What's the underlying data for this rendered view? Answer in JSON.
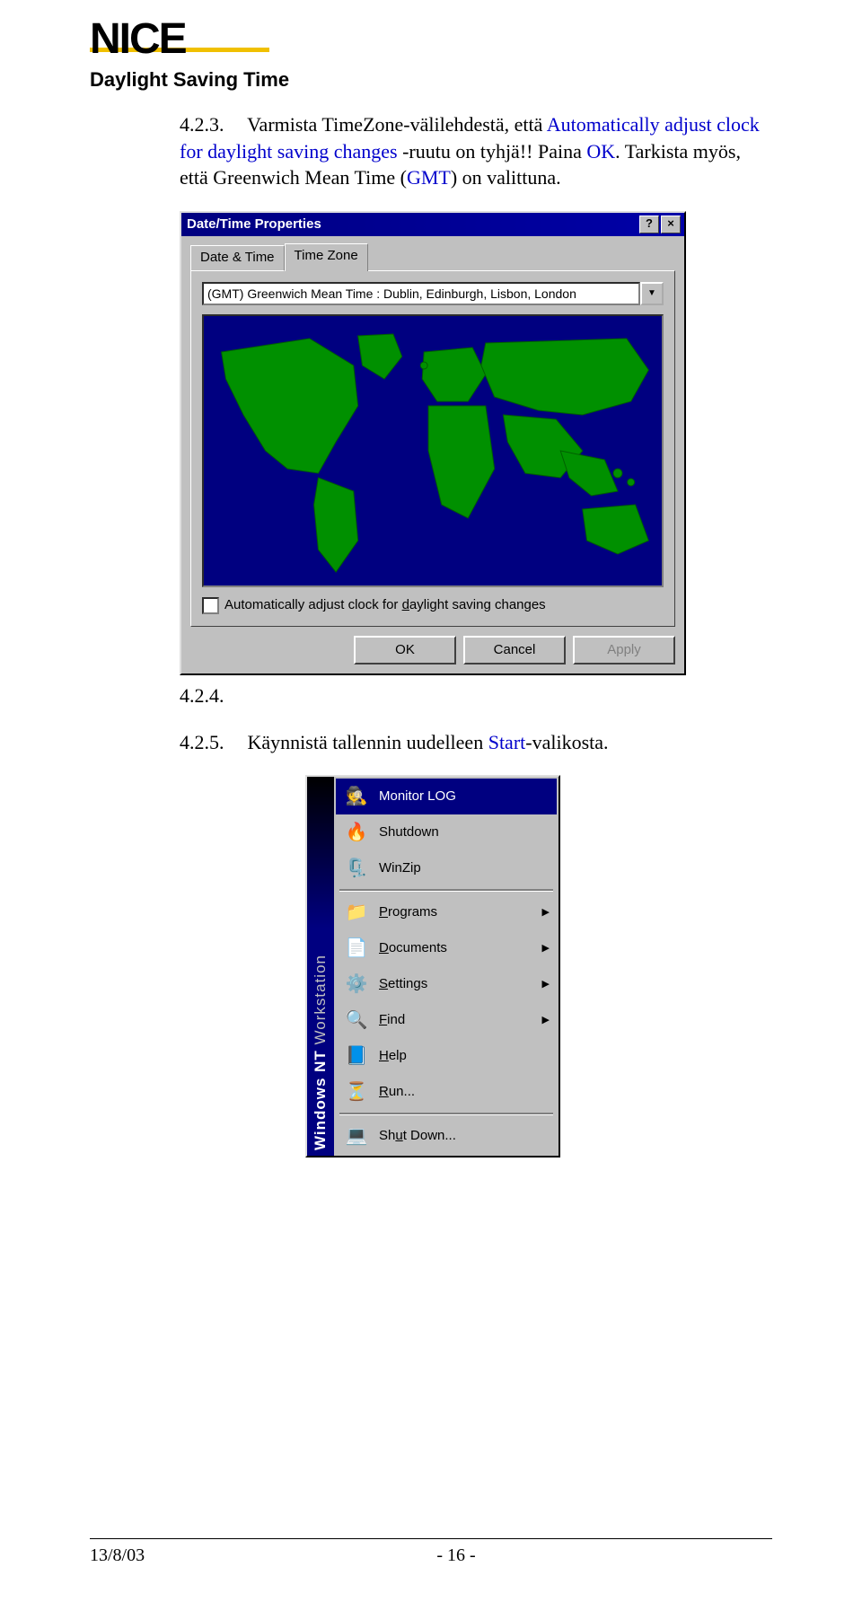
{
  "logo": {
    "text": "NICE"
  },
  "header": {
    "title": "Daylight Saving Time"
  },
  "sections": {
    "s423": {
      "num": "4.2.3.",
      "pre": "Varmista TimeZone-välilehdestä, että ",
      "blue1": "Automatically adjust clock for daylight saving changes",
      "mid1": " -ruutu on tyhjä!! Paina ",
      "blue2": "OK",
      "mid2": ". Tarkista myös, että Greenwich Mean Time (",
      "blue3": "GMT",
      "mid3": ") on valittuna."
    },
    "s424": {
      "num": "4.2.4."
    },
    "s425": {
      "num": "4.2.5.",
      "pre": "Käynnistä tallennin uudelleen ",
      "blue1": "Start",
      "post": "-valikosta."
    }
  },
  "dtwindow": {
    "title": "Date/Time Properties",
    "help_btn": "?",
    "close_btn": "×",
    "tabs": {
      "datetime": "Date & Time",
      "timezone": "Time Zone"
    },
    "tz_selected": "(GMT) Greenwich Mean Time : Dublin, Edinburgh, Lisbon, London",
    "checkbox": "Automatically adjust clock for daylight saving changes",
    "ok": "OK",
    "cancel": "Cancel",
    "apply": "Apply"
  },
  "startmenu": {
    "sidebar1": "Windows NT",
    "sidebar2": "Workstation",
    "items": {
      "monitor": "Monitor LOG",
      "shutdown": "Shutdown",
      "winzip": "WinZip",
      "programs": "Programs",
      "documents": "Documents",
      "settings": "Settings",
      "find": "Find",
      "help": "Help",
      "run": "Run...",
      "shut_down": "Shut Down..."
    }
  },
  "footer": {
    "date": "13/8/03",
    "page": "- 16 -"
  }
}
